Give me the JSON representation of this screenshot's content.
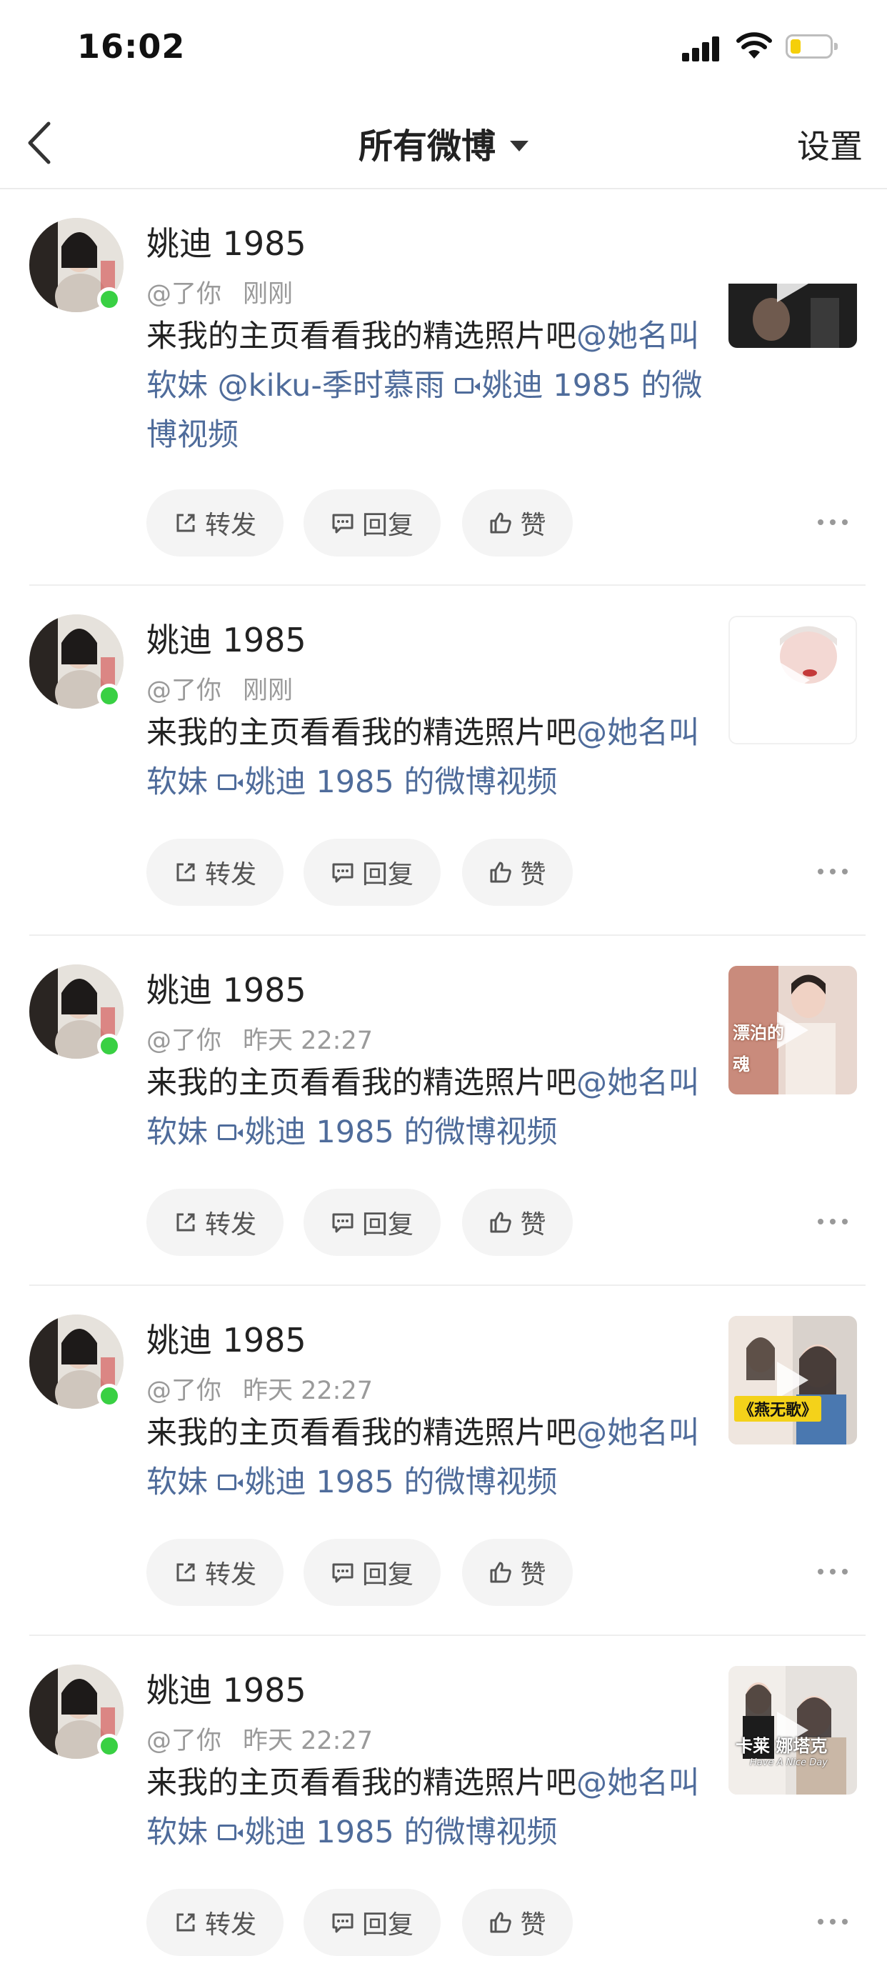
{
  "status_bar": {
    "time": "16:02"
  },
  "nav": {
    "title": "所有微博",
    "settings": "设置"
  },
  "actions": {
    "repost": "转发",
    "reply": "回复",
    "like": "赞"
  },
  "posts": [
    {
      "name": "姚迪 1985",
      "mention": "@了你",
      "time": "刚刚",
      "text": "来我的主页看看我的精选照片吧",
      "link1": "@她名叫软妹",
      "link2": "@kiku-季时慕雨",
      "video": "姚迪 1985 的微博视频"
    },
    {
      "name": "姚迪 1985",
      "mention": "@了你",
      "time": "刚刚",
      "text": "来我的主页看看我的精选照片吧",
      "link1": "@她名叫软妹",
      "video": "姚迪 1985 的微博视频"
    },
    {
      "name": "姚迪 1985",
      "mention": "@了你",
      "time": "昨天 22:27",
      "text": "来我的主页看看我的精选照片吧",
      "link1": "@她名叫软妹",
      "video": "姚迪 1985 的微博视频",
      "thumb_caption": "漂泊的魂"
    },
    {
      "name": "姚迪 1985",
      "mention": "@了你",
      "time": "昨天 22:27",
      "text": "来我的主页看看我的精选照片吧",
      "link1": "@她名叫软妹",
      "video": "姚迪 1985 的微博视频",
      "thumb_caption": "《燕无歌》"
    },
    {
      "name": "姚迪 1985",
      "mention": "@了你",
      "time": "昨天 22:27",
      "text": "来我的主页看看我的精选照片吧",
      "link1": "@她名叫软妹",
      "video": "姚迪 1985 的微博视频",
      "thumb_caption": "卡莱 娜塔克",
      "thumb_subcaption": "Have A Nice Day"
    }
  ]
}
